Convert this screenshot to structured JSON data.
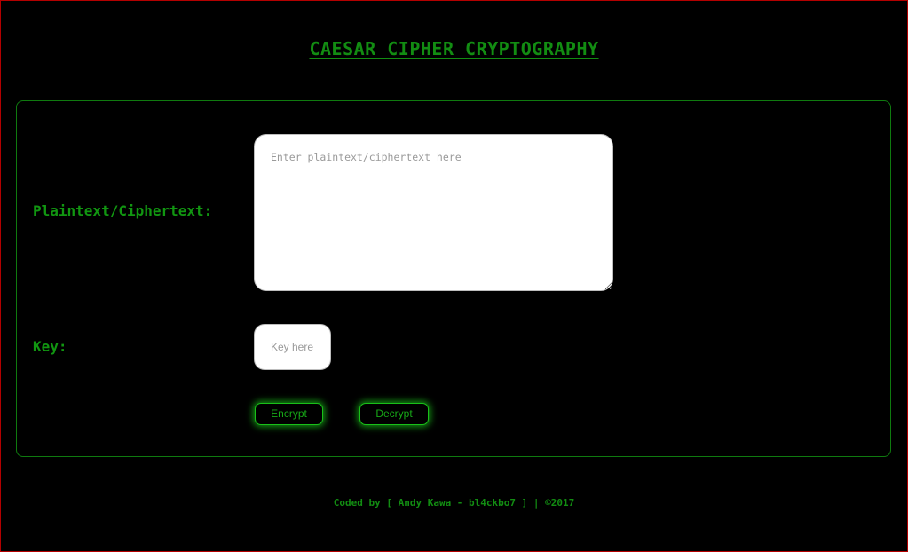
{
  "header": {
    "title": "CAESAR CIPHER CRYPTOGRAPHY"
  },
  "form": {
    "text_label": "Plaintext/Ciphertext:",
    "text_placeholder": "Enter plaintext/ciphertext here",
    "text_value": "",
    "key_label": "Key:",
    "key_placeholder": "Key here",
    "key_value": "",
    "encrypt_label": "Encrypt",
    "decrypt_label": "Decrypt"
  },
  "footer": {
    "credit": "Coded by [ Andy Kawa - bl4ckbo7 ] | ©2017"
  },
  "colors": {
    "background": "#000000",
    "accent_green": "#128c12",
    "glow_green": "#19c019",
    "window_border": "#b30000"
  }
}
